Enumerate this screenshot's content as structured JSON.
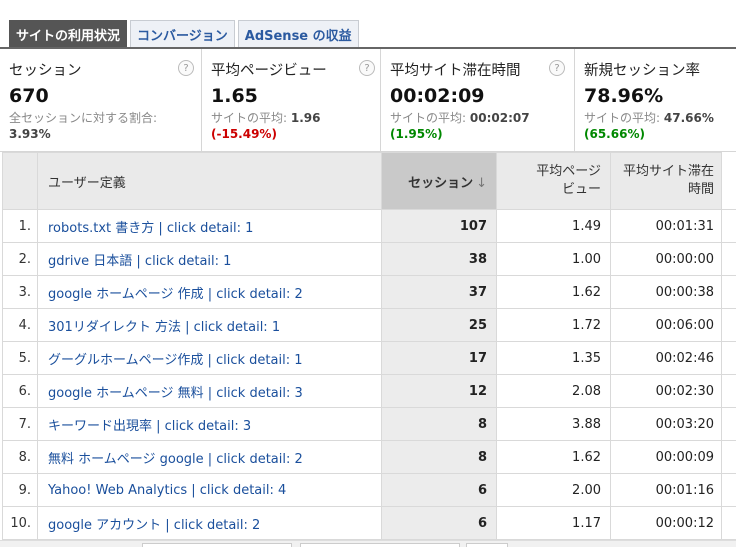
{
  "tabs": [
    {
      "label": "サイトの利用状況",
      "active": true
    },
    {
      "label": "コンバージョン",
      "active": false
    },
    {
      "label": "AdSense の収益",
      "active": false
    }
  ],
  "scorecards": [
    {
      "label": "セッション",
      "value": "670",
      "sub": "全セッションに対する割合:",
      "sub_value": "",
      "pct": "3.93%",
      "pct_kind": "plain"
    },
    {
      "label": "平均ページビュー",
      "value": "1.65",
      "sub": "サイトの平均:",
      "sub_value": "1.96",
      "pct": "(-15.49%)",
      "pct_kind": "neg"
    },
    {
      "label": "平均サイト滞在時間",
      "value": "00:02:09",
      "sub": "サイトの平均:",
      "sub_value": "00:02:07",
      "pct": "(1.95%)",
      "pct_kind": "pos"
    },
    {
      "label": "新規セッション率",
      "value": "78.96%",
      "sub": "サイトの平均:",
      "sub_value": "47.66%",
      "pct": "(65.66%)",
      "pct_kind": "pos"
    }
  ],
  "help_glyph": "?",
  "table": {
    "headers": {
      "dimension": "ユーザー定義",
      "sessions": "セッション",
      "sort_arrow": "↓",
      "pageviews_line1": "平均ページ",
      "pageviews_line2": "ビュー",
      "duration_line1": "平均サイト滞在",
      "duration_line2": "時間"
    },
    "rows": [
      {
        "n": "1.",
        "dim": "robots.txt 書き方 | click detail: 1",
        "sessions": "107",
        "pv": "1.49",
        "dur": "00:01:31"
      },
      {
        "n": "2.",
        "dim": "gdrive 日本語 | click detail: 1",
        "sessions": "38",
        "pv": "1.00",
        "dur": "00:00:00"
      },
      {
        "n": "3.",
        "dim": "google ホームページ 作成 | click detail: 2",
        "sessions": "37",
        "pv": "1.62",
        "dur": "00:00:38"
      },
      {
        "n": "4.",
        "dim": "301リダイレクト 方法 | click detail: 1",
        "sessions": "25",
        "pv": "1.72",
        "dur": "00:06:00"
      },
      {
        "n": "5.",
        "dim": "グーグルホームページ作成 | click detail: 1",
        "sessions": "17",
        "pv": "1.35",
        "dur": "00:02:46"
      },
      {
        "n": "6.",
        "dim": "google ホームページ 無料 | click detail: 3",
        "sessions": "12",
        "pv": "2.08",
        "dur": "00:02:30"
      },
      {
        "n": "7.",
        "dim": "キーワード出現率 | click detail: 3",
        "sessions": "8",
        "pv": "3.88",
        "dur": "00:03:20"
      },
      {
        "n": "8.",
        "dim": "無料 ホームページ google | click detail: 2",
        "sessions": "8",
        "pv": "1.62",
        "dur": "00:00:09"
      },
      {
        "n": "9.",
        "dim": "Yahoo! Web Analytics | click detail: 4",
        "sessions": "6",
        "pv": "2.00",
        "dur": "00:01:16"
      },
      {
        "n": "10.",
        "dim": "google アカウント | click detail: 2",
        "sessions": "6",
        "pv": "1.17",
        "dur": "00:00:12"
      }
    ]
  }
}
